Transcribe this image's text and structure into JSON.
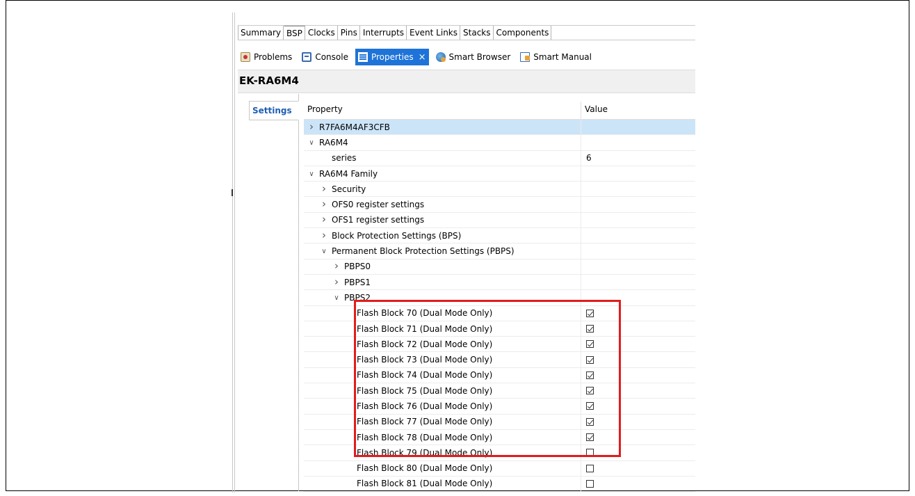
{
  "editor_tabs": [
    "Summary",
    "BSP",
    "Clocks",
    "Pins",
    "Interrupts",
    "Event Links",
    "Stacks",
    "Components"
  ],
  "view_tabs": [
    {
      "label": "Problems",
      "icon": "problems-icon"
    },
    {
      "label": "Console",
      "icon": "console-icon"
    },
    {
      "label": "Properties",
      "icon": "properties-icon",
      "active": true,
      "close": "×"
    },
    {
      "label": "Smart Browser",
      "icon": "smart-browser-icon"
    },
    {
      "label": "Smart Manual",
      "icon": "smart-manual-icon"
    }
  ],
  "panel_title": "EK-RA6M4",
  "settings_tab": "Settings",
  "table": {
    "header_property": "Property",
    "header_value": "Value",
    "rows": [
      {
        "label": "R7FA6M4AF3CFB",
        "indent": 0,
        "toggle": "collapsed",
        "value": "",
        "selected": true
      },
      {
        "label": "RA6M4",
        "indent": 0,
        "toggle": "expanded",
        "value": ""
      },
      {
        "label": "series",
        "indent": 2,
        "toggle": "none",
        "value": "6"
      },
      {
        "label": "RA6M4 Family",
        "indent": 0,
        "toggle": "expanded",
        "value": ""
      },
      {
        "label": "Security",
        "indent": 1,
        "toggle": "collapsed",
        "value": ""
      },
      {
        "label": "OFS0 register settings",
        "indent": 1,
        "toggle": "collapsed",
        "value": ""
      },
      {
        "label": "OFS1 register settings",
        "indent": 1,
        "toggle": "collapsed",
        "value": ""
      },
      {
        "label": "Block Protection Settings (BPS)",
        "indent": 1,
        "toggle": "collapsed",
        "value": ""
      },
      {
        "label": "Permanent Block Protection Settings (PBPS)",
        "indent": 1,
        "toggle": "expanded",
        "value": ""
      },
      {
        "label": "PBPS0",
        "indent": 2,
        "toggle": "collapsed",
        "value": ""
      },
      {
        "label": "PBPS1",
        "indent": 2,
        "toggle": "collapsed",
        "value": ""
      },
      {
        "label": "PBPS2",
        "indent": 2,
        "toggle": "expanded",
        "value": ""
      },
      {
        "label": "Flash Block 70 (Dual Mode Only)",
        "indent": 4,
        "toggle": "none",
        "checkbox": true,
        "checked": true
      },
      {
        "label": "Flash Block 71 (Dual Mode Only)",
        "indent": 4,
        "toggle": "none",
        "checkbox": true,
        "checked": true
      },
      {
        "label": "Flash Block 72 (Dual Mode Only)",
        "indent": 4,
        "toggle": "none",
        "checkbox": true,
        "checked": true
      },
      {
        "label": "Flash Block 73 (Dual Mode Only)",
        "indent": 4,
        "toggle": "none",
        "checkbox": true,
        "checked": true
      },
      {
        "label": "Flash Block 74 (Dual Mode Only)",
        "indent": 4,
        "toggle": "none",
        "checkbox": true,
        "checked": true
      },
      {
        "label": "Flash Block 75 (Dual Mode Only)",
        "indent": 4,
        "toggle": "none",
        "checkbox": true,
        "checked": true
      },
      {
        "label": "Flash Block 76 (Dual Mode Only)",
        "indent": 4,
        "toggle": "none",
        "checkbox": true,
        "checked": true
      },
      {
        "label": "Flash Block 77 (Dual Mode Only)",
        "indent": 4,
        "toggle": "none",
        "checkbox": true,
        "checked": true
      },
      {
        "label": "Flash Block 78 (Dual Mode Only)",
        "indent": 4,
        "toggle": "none",
        "checkbox": true,
        "checked": true
      },
      {
        "label": "Flash Block 79 (Dual Mode Only)",
        "indent": 4,
        "toggle": "none",
        "checkbox": true,
        "checked": false
      },
      {
        "label": "Flash Block 80 (Dual Mode Only)",
        "indent": 4,
        "toggle": "none",
        "checkbox": true,
        "checked": false
      },
      {
        "label": "Flash Block 81 (Dual Mode Only)",
        "indent": 4,
        "toggle": "none",
        "checkbox": true,
        "checked": false
      }
    ]
  },
  "colors": {
    "highlight": "#e21c1c",
    "active_tab": "#1e73d8",
    "selected_row": "#cce4f7",
    "settings_text": "#1e5fb4"
  }
}
